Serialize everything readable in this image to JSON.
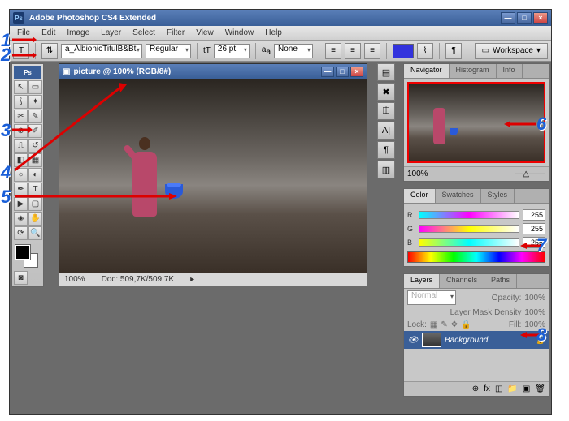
{
  "app": {
    "title": "Adobe Photoshop CS4 Extended"
  },
  "menu": [
    "File",
    "Edit",
    "Image",
    "Layer",
    "Select",
    "Filter",
    "View",
    "Window",
    "Help"
  ],
  "options": {
    "font": "a_AlbionicTitulB&Bt",
    "style": "Regular",
    "size": "26 pt",
    "aa": "None",
    "workspace": "Workspace"
  },
  "document": {
    "title": "picture @ 100% (RGB/8#)",
    "zoom": "100%",
    "docsize": "Doc: 509,7K/509,7K"
  },
  "navigator": {
    "tabs": [
      "Navigator",
      "Histogram",
      "Info"
    ],
    "zoom": "100%"
  },
  "color": {
    "tabs": [
      "Color",
      "Swatches",
      "Styles"
    ],
    "r": "255",
    "g": "255",
    "b": "255"
  },
  "layers": {
    "tabs": [
      "Layers",
      "Channels",
      "Paths"
    ],
    "blend": "Normal",
    "opacity_label": "Opacity:",
    "opacity": "100%",
    "density_label": "Layer Mask Density",
    "density": "100%",
    "lock_label": "Lock:",
    "fill_label": "Fill:",
    "fill": "100%",
    "bg_name": "Background"
  },
  "callouts": {
    "c1": "1",
    "c2": "2",
    "c3": "3",
    "c4": "4",
    "c5": "5",
    "c6": "6",
    "c7": "7",
    "c8": "8"
  }
}
